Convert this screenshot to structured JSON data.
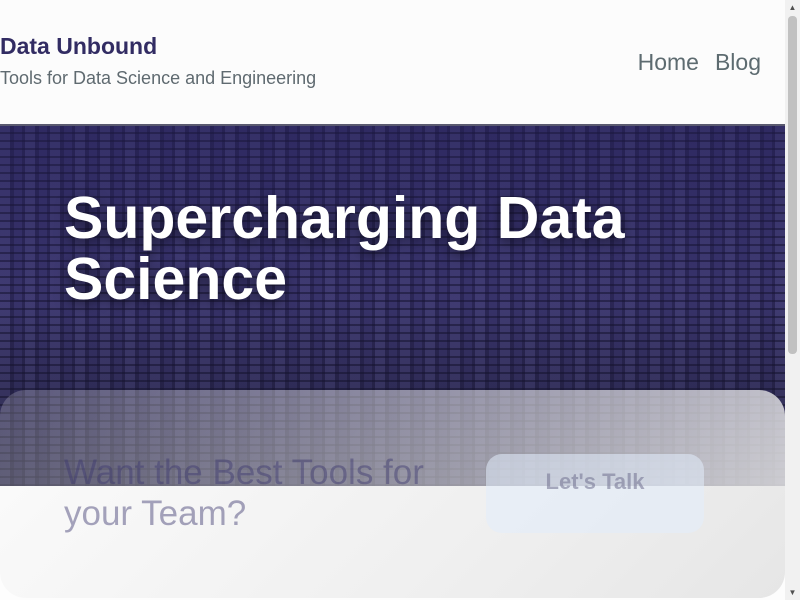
{
  "header": {
    "brand_title": "Data Unbound",
    "tagline": "Tools for Data Science and Engineering",
    "nav": {
      "home": "Home",
      "blog": "Blog"
    }
  },
  "hero": {
    "title": "Supercharging Data Science"
  },
  "cta": {
    "heading": "Want the Best Tools for your Team?",
    "button_label": "Let's Talk"
  },
  "scrollbar": {
    "up_icon": "▲",
    "down_icon": "▼"
  },
  "colors": {
    "brand": "#322c63",
    "hero_background": "#2f2a5e",
    "cta_button": "#e2ecfc"
  }
}
